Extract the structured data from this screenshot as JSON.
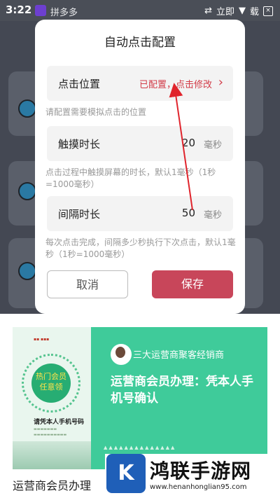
{
  "status_bar": {
    "time": "3:22",
    "app_label": "拼多多",
    "right_text": "立即",
    "right_char": "载"
  },
  "dialog": {
    "title": "自动点击配置",
    "position_row": {
      "label": "点击位置",
      "value": "已配置，点击修改",
      "chevron": "›"
    },
    "position_hint": "请配置需要模拟点击的位置",
    "touch_row": {
      "label": "触摸时长",
      "value": "20",
      "unit": "毫秒"
    },
    "touch_hint": "点击过程中触摸屏幕的时长，默认1毫秒（1秒=1000毫秒）",
    "interval_row": {
      "label": "间隔时长",
      "value": "50",
      "unit": "毫秒"
    },
    "interval_hint": "每次点击完成，间隔多少秒执行下次点击，默认1毫秒（1秒=1000毫秒）",
    "cancel_label": "取消",
    "save_label": "保存"
  },
  "ad": {
    "badge": "热门会员\n任意领",
    "left_caption": "请凭本人手机号码",
    "account_name": "三大运营商聚客经销商",
    "headline": "运营商会员办理：凭本人手机号确认"
  },
  "caption": "运营商会员办理",
  "watermark": {
    "name": "鸿联手游网",
    "url": "www.henanhonglian95.com"
  },
  "colors": {
    "accent": "#c8465a",
    "link_red": "#d23c48",
    "ad_green": "#3fcb9a"
  }
}
